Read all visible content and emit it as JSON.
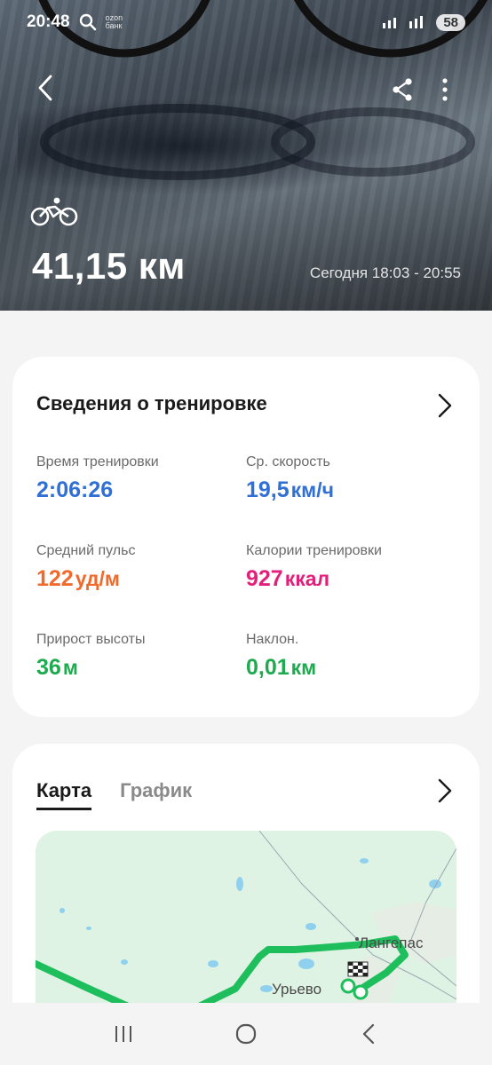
{
  "status_bar": {
    "time": "20:48",
    "ozon_label": "ozon банк",
    "battery": "58"
  },
  "header": {
    "activity_icon": "bicycle-icon",
    "distance": "41,15 км",
    "date_range": "Сегодня 18:03 - 20:55"
  },
  "summary": {
    "title": "Сведения о тренировке",
    "metrics": [
      {
        "label": "Время тренировки",
        "value": "2:06:26",
        "unit": "",
        "color": "#2f6fd6"
      },
      {
        "label": "Ср. скорость",
        "value": "19,5",
        "unit": "км/ч",
        "color": "#2f6fd6"
      },
      {
        "label": "Средний пульс",
        "value": "122",
        "unit": "уд/м",
        "color": "#f06a2c"
      },
      {
        "label": "Калории тренировки",
        "value": "927",
        "unit": "ккал",
        "color": "#e2207c"
      },
      {
        "label": "Прирост высоты",
        "value": "36",
        "unit": "м",
        "color": "#1eaa4e"
      },
      {
        "label": "Наклон.",
        "value": "0,01",
        "unit": "км",
        "color": "#1eaa4e"
      }
    ]
  },
  "map_card": {
    "tabs": [
      {
        "label": "Карта",
        "active": true
      },
      {
        "label": "График",
        "active": false
      }
    ],
    "place_labels": {
      "city": "Лангепас",
      "village": "Урьево"
    },
    "route_color": "#1fbe5c"
  }
}
